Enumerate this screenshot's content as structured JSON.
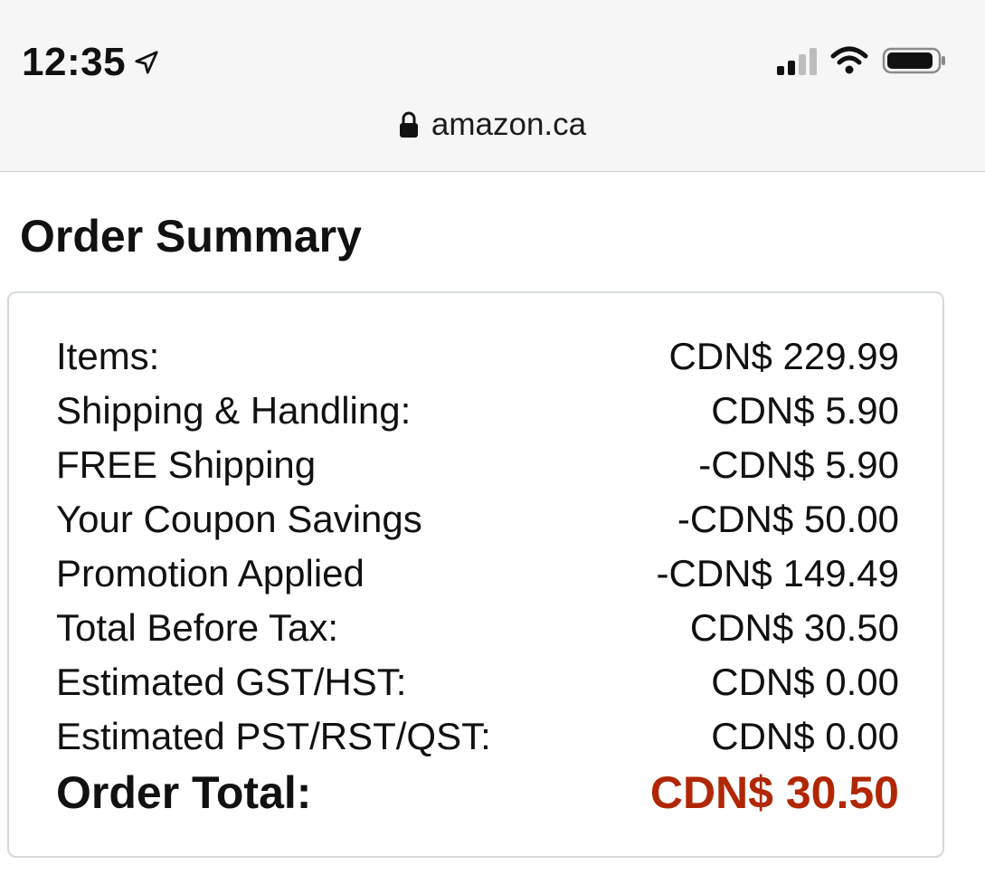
{
  "status_bar": {
    "time": "12:35",
    "location_icon": "location-arrow-icon",
    "signal_icon": "cellular-signal-icon",
    "wifi_icon": "wifi-icon",
    "battery_icon": "battery-icon"
  },
  "browser": {
    "lock_icon": "lock-icon",
    "url": "amazon.ca"
  },
  "order_summary": {
    "title": "Order Summary",
    "rows": [
      {
        "label": "Items:",
        "value": "CDN$ 229.99"
      },
      {
        "label": "Shipping & Handling:",
        "value": "CDN$ 5.90"
      },
      {
        "label": "FREE Shipping",
        "value": "-CDN$ 5.90"
      },
      {
        "label": "Your Coupon Savings",
        "value": "-CDN$ 50.00"
      },
      {
        "label": "Promotion Applied",
        "value": "-CDN$ 149.49"
      },
      {
        "label": "Total Before Tax:",
        "value": "CDN$ 30.50"
      },
      {
        "label": "Estimated GST/HST:",
        "value": "CDN$ 0.00"
      },
      {
        "label": "Estimated PST/RST/QST:",
        "value": "CDN$ 0.00"
      }
    ],
    "total": {
      "label": "Order Total:",
      "value": "CDN$ 30.50"
    }
  },
  "colors": {
    "total_price": "#b12704",
    "top_bar_bg": "#f6f6f6",
    "box_border": "#d5d9d9"
  }
}
